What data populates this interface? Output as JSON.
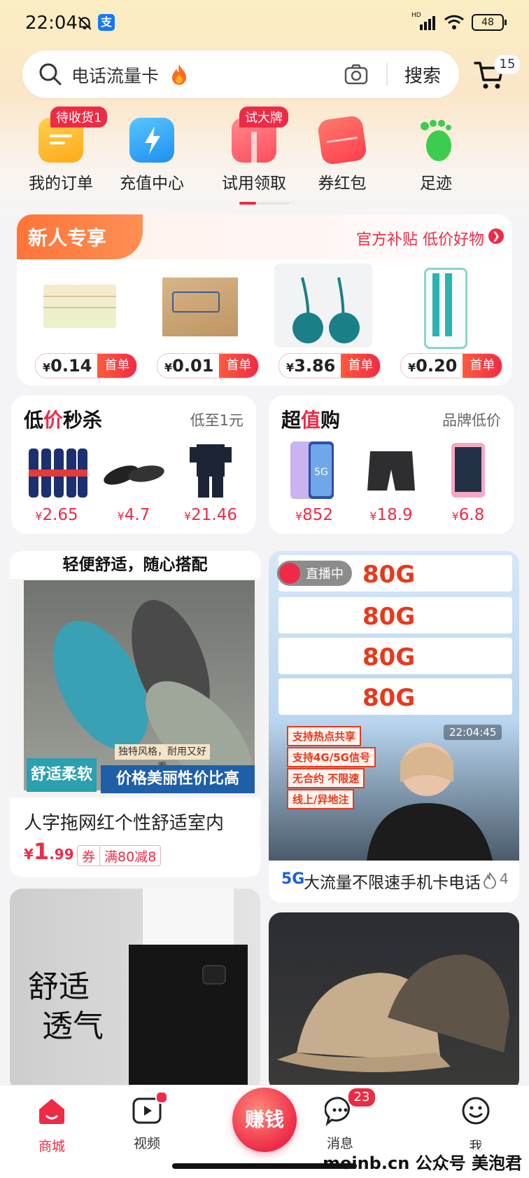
{
  "status": {
    "time": "22:04",
    "signal": "HD",
    "battery": "48"
  },
  "search": {
    "query": "电话流量卡",
    "button": "搜索",
    "cart_count": "15"
  },
  "shortcuts": [
    {
      "label": "我的订单",
      "tag": "待收货1",
      "color": "#ffb51e"
    },
    {
      "label": "充值中心",
      "tag": "",
      "color": "#2ea7f2"
    },
    {
      "label": "试用领取",
      "tag": "试大牌",
      "color": "#ff5d5d"
    },
    {
      "label": "券红包",
      "tag": "",
      "color": "#ff4d4f"
    },
    {
      "label": "足迹",
      "tag": "",
      "color": "#3ccd4e"
    }
  ],
  "new_user": {
    "title": "新人专享",
    "subtitle": "官方补贴 低价好物",
    "items": [
      {
        "currency": "¥",
        "price": "0.14",
        "tag": "首单"
      },
      {
        "currency": "¥",
        "price": "0.01",
        "tag": "首单"
      },
      {
        "currency": "¥",
        "price": "3.86",
        "tag": "首单"
      },
      {
        "currency": "¥",
        "price": "0.20",
        "tag": "首单"
      }
    ]
  },
  "flash_sale": {
    "title_a": "低",
    "title_b": "价",
    "title_c": "秒杀",
    "subtitle": "低至1元",
    "items": [
      {
        "currency": "¥",
        "price": "2.65"
      },
      {
        "currency": "¥",
        "price": "4.7"
      },
      {
        "currency": "¥",
        "price": "21.46"
      }
    ]
  },
  "value_buy": {
    "title_a": "超",
    "title_b": "值",
    "title_c": "购",
    "subtitle": "品牌低价",
    "items": [
      {
        "currency": "¥",
        "price": "852"
      },
      {
        "currency": "¥",
        "price": "18.9"
      },
      {
        "currency": "¥",
        "price": "6.8"
      }
    ]
  },
  "feed": {
    "slipper": {
      "banner": "轻便舒适，随心搭配",
      "overlay_left": "舒适柔软",
      "overlay_small": "独特风格，耐用又好看",
      "overlay_right": "价格美丽性价比高",
      "title": "人字拖网红个性舒适室内",
      "currency": "¥",
      "price_int": "1",
      "price_dec": ".99",
      "coupon_q": "券",
      "coupon_t": "满80减8"
    },
    "live": {
      "live_label": "直播中",
      "timestamp": "22:04:45",
      "data_size": "80G",
      "stickers": [
        "支持热点共享",
        "支持4G/5G信号",
        "无合约 不限速",
        "线上/异地注"
      ],
      "badge": "5G",
      "title": "大流量不限速手机卡电话",
      "heat": "4"
    },
    "shorts": {
      "line1": "舒适",
      "line2": "透气"
    }
  },
  "bottom_nav": [
    {
      "label": "商城"
    },
    {
      "label": "视频"
    },
    {
      "label": "赚钱"
    },
    {
      "label": "消息",
      "badge": "23"
    },
    {
      "label": "我"
    }
  ],
  "watermark": "meinb.cn 公众号 美泡君"
}
